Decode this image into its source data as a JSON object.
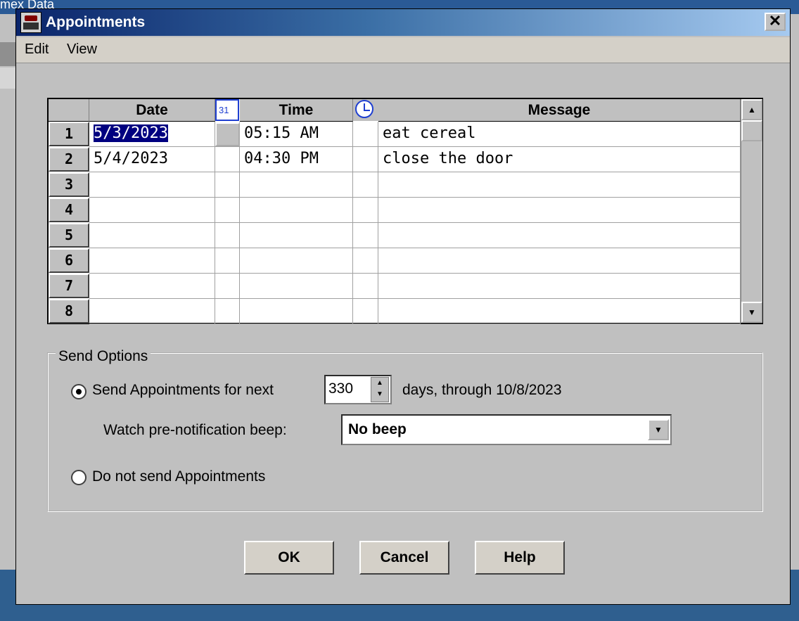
{
  "window": {
    "title": "Appointments",
    "close_glyph": "✕"
  },
  "background": {
    "title_fragment": "mex Data"
  },
  "menu": {
    "items": [
      "Edit",
      "View"
    ]
  },
  "grid": {
    "columns": [
      "Date",
      "",
      "Time",
      "",
      "Message"
    ],
    "calendar_icon_text": "31",
    "row_numbers": [
      "1",
      "2",
      "3",
      "4",
      "5",
      "6",
      "7",
      "8"
    ],
    "rows": [
      {
        "date": "5/3/2023",
        "time": "05:15 AM",
        "message": "eat cereal",
        "selected": true
      },
      {
        "date": "5/4/2023",
        "time": "04:30 PM",
        "message": "close the door"
      },
      {
        "date": "",
        "time": "",
        "message": ""
      },
      {
        "date": "",
        "time": "",
        "message": ""
      },
      {
        "date": "",
        "time": "",
        "message": ""
      },
      {
        "date": "",
        "time": "",
        "message": ""
      },
      {
        "date": "",
        "time": "",
        "message": ""
      },
      {
        "date": "",
        "time": "",
        "message": ""
      }
    ]
  },
  "send_options": {
    "group_label": "Send Options",
    "send_label": "Send Appointments for next",
    "days_value": "330",
    "days_suffix": "days, through 10/8/2023",
    "beep_label": "Watch pre-notification beep:",
    "beep_value": "No beep",
    "no_send_label": "Do not send Appointments",
    "selected": "send"
  },
  "buttons": {
    "ok": "OK",
    "cancel": "Cancel",
    "help": "Help"
  }
}
